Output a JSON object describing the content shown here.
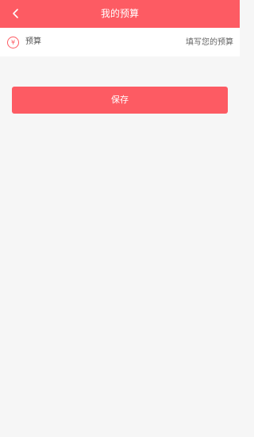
{
  "header": {
    "title": "我的预算",
    "back_icon": "chevron-left-icon"
  },
  "budget_row": {
    "icon_glyph": "¥",
    "icon": "yen-icon",
    "label": "预算",
    "input_value": "",
    "input_placeholder": "填写您的预算"
  },
  "save_button": {
    "label": "保存"
  },
  "colors": {
    "accent": "#fd5b63",
    "background": "#f6f6f6",
    "row_background": "#ffffff"
  }
}
